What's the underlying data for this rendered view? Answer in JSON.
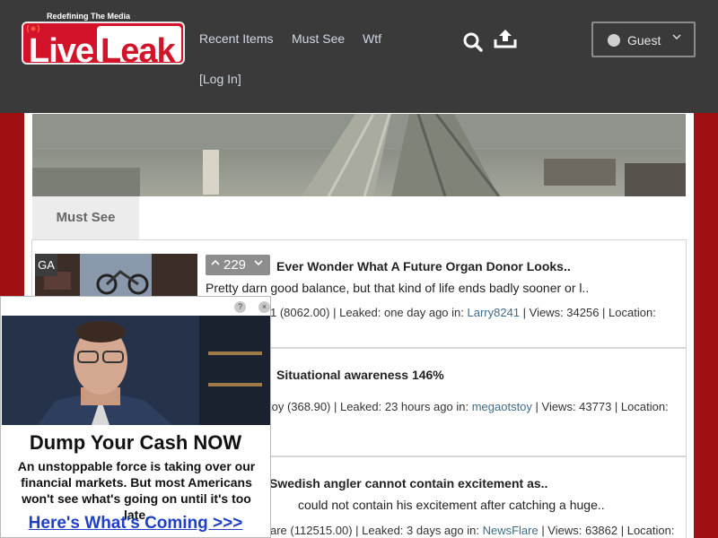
{
  "header": {
    "logo": {
      "tagline": "Redefining The Media",
      "word1": "Live",
      "word2": "Leak"
    },
    "nav": [
      {
        "label": "Recent Items"
      },
      {
        "label": "Must See"
      },
      {
        "label": "Wtf"
      },
      {
        "label": "[Log In]"
      }
    ],
    "user_menu": {
      "label": "Guest"
    }
  },
  "tabs": [
    {
      "label": "Must See"
    }
  ],
  "items": [
    {
      "badge": "GA",
      "votes": "229",
      "title": "Ever Wonder What A Future Organ Donor Looks..",
      "description": "Pretty darn good balance, but that kind of life ends badly sooner or l..",
      "meta_prefix": "1 (8062.00) | Leaked: one day ago in: ",
      "channel": "Larry8241",
      "meta_suffix": " | Views: 34256 | Location:"
    },
    {
      "title": "Situational awareness 146%",
      "meta_prefix": "toy (368.90) | Leaked: 23 hours ago in: ",
      "channel": "megaotstoy",
      "meta_suffix": " | Views: 43773 | Location:"
    },
    {
      "title": "Swedish angler cannot contain excitement as..",
      "description": "could not contain his excitement after catching a huge..",
      "meta_prefix": "are (112515.00) | Leaked: 3 days ago in: ",
      "channel": "NewsFlare",
      "meta_suffix": " | Views: 63862 | Location:"
    }
  ],
  "ad": {
    "help": "?",
    "close": "×",
    "headline": "Dump Your Cash NOW",
    "body": "An unstoppable force is taking over our financial markets. But most Americans won't see what's going on until it's too late.",
    "cta": "Here's What's Coming >>>"
  },
  "colors": {
    "header_bg": "#3a3a3a",
    "brand_red": "#d3132a",
    "side_red": "#a00f12",
    "link": "#3d6c8a"
  }
}
